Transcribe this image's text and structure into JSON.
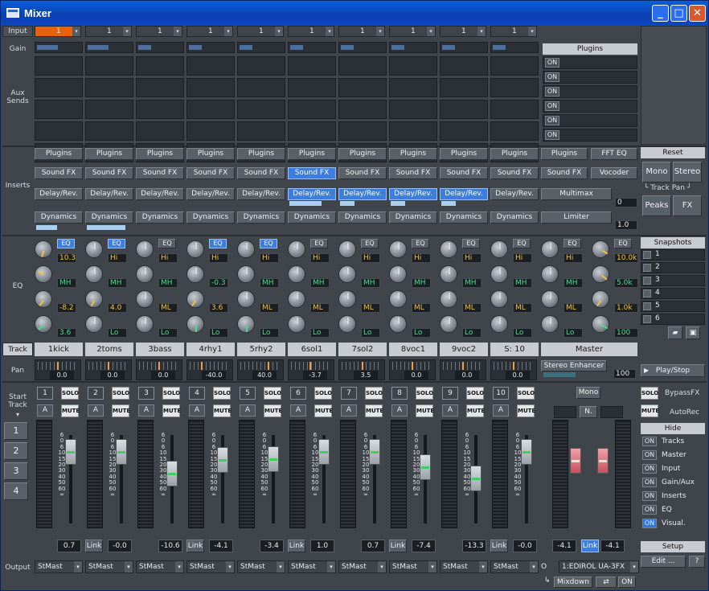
{
  "window": {
    "title": "Mixer",
    "min": "_",
    "max": "□",
    "close": "✕"
  },
  "labels": {
    "input": "Input",
    "gain": "Gain",
    "aux1": "Aux",
    "aux2": "Sends",
    "inserts": "Inserts",
    "eq": "EQ",
    "track": "Track",
    "pan": "Pan",
    "start1": "Start",
    "start2": "Track",
    "output": "Output"
  },
  "inputs": [
    "1",
    "1",
    "1",
    "1",
    "1",
    "1",
    "1",
    "1",
    "1",
    "1"
  ],
  "plugins_header": "Plugins",
  "on": "ON",
  "insert_labels": {
    "plugins": "Plugins",
    "soundfx": "Sound FX",
    "delay": "Delay/Rev.",
    "dynamics": "Dynamics"
  },
  "master_inserts": {
    "plugins": "Plugins",
    "fft": "FFT EQ",
    "soundfx": "Sound FX",
    "vocoder": "Vocoder",
    "multimax": "Multimax",
    "limiter": "Limiter",
    "v1": "0",
    "v2": "1.0"
  },
  "reset": {
    "header": "Reset",
    "mono": "Mono",
    "stereo": "Stereo",
    "trackpan": "└ Track Pan ┘",
    "peaks": "Peaks",
    "fx": "FX"
  },
  "eq_btn": "EQ",
  "eq": [
    {
      "hi": "10.3",
      "mh": "MH",
      "ml": "-8.2",
      "lo": "3.6",
      "on": true
    },
    {
      "hi": "Hi",
      "mh": "MH",
      "ml": "4.0",
      "lo": "Lo",
      "on": true
    },
    {
      "hi": "Hi",
      "mh": "MH",
      "ml": "ML",
      "lo": "Lo",
      "on": false
    },
    {
      "hi": "Hi",
      "mh": "-0.3",
      "ml": "3.6",
      "lo": "Lo",
      "on": true
    },
    {
      "hi": "Hi",
      "mh": "MH",
      "ml": "ML",
      "lo": "Lo",
      "on": true
    },
    {
      "hi": "Hi",
      "mh": "MH",
      "ml": "ML",
      "lo": "Lo",
      "on": false
    },
    {
      "hi": "Hi",
      "mh": "MH",
      "ml": "ML",
      "lo": "Lo",
      "on": false
    },
    {
      "hi": "Hi",
      "mh": "MH",
      "ml": "ML",
      "lo": "Lo",
      "on": false
    },
    {
      "hi": "Hi",
      "mh": "MH",
      "ml": "ML",
      "lo": "Lo",
      "on": false
    },
    {
      "hi": "Hi",
      "mh": "MH",
      "ml": "ML",
      "lo": "Lo",
      "on": false
    },
    {
      "hi": "Hi",
      "mh": "MH",
      "ml": "ML",
      "lo": "Lo",
      "on": false
    },
    {
      "hi": "10.0k",
      "mh": "5.0k",
      "ml": "1.0k",
      "lo": "100",
      "on": false
    }
  ],
  "snapshots": {
    "header": "Snapshots",
    "items": [
      "1",
      "2",
      "3",
      "4",
      "5",
      "6"
    ]
  },
  "tracks": [
    "1kick",
    "2toms",
    "3bass",
    "4rhy1",
    "5rhy2",
    "6sol1",
    "7sol2",
    "8voc1",
    "9voc2",
    "S: 10"
  ],
  "master": "Master",
  "pan": [
    "0.0",
    "0.0",
    "0.0",
    "-40.0",
    "40.0",
    "-3.7",
    "3.5",
    "0.0",
    "0.0",
    "0.0"
  ],
  "stereo_enhancer": "Stereo Enhancer",
  "stereo_val": "100",
  "playstop": "Play/Stop",
  "nums": [
    "1",
    "2",
    "3",
    "4",
    "5",
    "6",
    "7",
    "8",
    "9",
    "10"
  ],
  "solo": "SOLO",
  "mute": "MUTE",
  "a": "A",
  "master_mono": "Mono",
  "master_n": "N.",
  "bypass": "BypassFX",
  "autorec": "AutoRec",
  "hide": {
    "header": "Hide",
    "items": [
      "Tracks",
      "Master",
      "Input",
      "Gain/Aux",
      "Inserts",
      "EQ",
      "Visual."
    ]
  },
  "setup": {
    "header": "Setup",
    "edit": "Edit ...",
    "help": "?"
  },
  "start_tracks": [
    "1",
    "2",
    "3",
    "4"
  ],
  "scale": [
    "6",
    "0",
    "6",
    "10",
    "15",
    "20",
    "30",
    "40",
    "50",
    "60",
    "∞"
  ],
  "fader_vals": [
    "0.7",
    "-0.0",
    "-10.6",
    "-4.1",
    "-3.4",
    "1.0",
    "0.7",
    "-7.4",
    "-13.3",
    "-0.0",
    "-4.1",
    "-4.1"
  ],
  "link": "Link",
  "outputs": [
    "StMast",
    "StMast",
    "StMast",
    "StMast",
    "StMast",
    "StMast",
    "StMast",
    "StMast",
    "StMast",
    "StMast"
  ],
  "master_out": "1:EDIROL UA-3FX",
  "master_out_prefix": "O",
  "mixdown": "Mixdown",
  "mix_on": "ON"
}
